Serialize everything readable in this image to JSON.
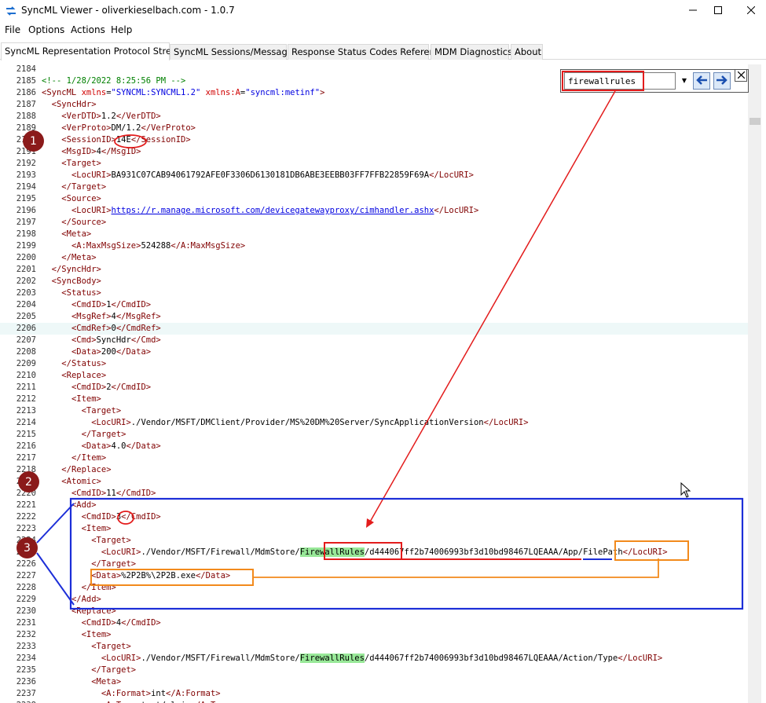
{
  "window": {
    "title": "SyncML Viewer - oliverkieselbach.com - 1.0.7",
    "minimize_icon": "minimize-icon",
    "maximize_icon": "maximize-icon",
    "close_icon": "close-icon"
  },
  "menu": [
    "File",
    "Options",
    "Actions",
    "Help"
  ],
  "tabs": [
    {
      "label": "SyncML Representation Protocol Stream",
      "active": true
    },
    {
      "label": "SyncML Sessions/Messages",
      "active": false
    },
    {
      "label": "Response Status Codes Reference",
      "active": false
    },
    {
      "label": "MDM Diagnostics",
      "active": false
    },
    {
      "label": "About",
      "active": false
    }
  ],
  "find": {
    "value": "firewallrules",
    "prev_icon": "arrow-left-icon",
    "next_icon": "arrow-right-icon",
    "close_icon": "close-icon"
  },
  "markers": [
    "1",
    "2",
    "3"
  ],
  "colors": {
    "tag": "#800000",
    "attribute": "#d00000",
    "string": "#0000e0",
    "comment": "#008000",
    "highlight": "#98e898",
    "annotation_red": "#e31c1c",
    "annotation_orange": "#f28a1c",
    "annotation_blue": "#1c2ed8",
    "marker": "#8b1a1a"
  },
  "editor": {
    "current_line": "2206",
    "lines": [
      {
        "n": "2184",
        "code": ""
      },
      {
        "n": "2185",
        "code": "<!-- 1/28/2022 8:25:56 PM -->"
      },
      {
        "n": "2186",
        "code": "<SyncML xmlns=\"SYNCML:SYNCML1.2\" xmlns:A=\"syncml:metinf\">"
      },
      {
        "n": "2187",
        "code": "  <SyncHdr>"
      },
      {
        "n": "2188",
        "code": "    <VerDTD>1.2</VerDTD>"
      },
      {
        "n": "2189",
        "code": "    <VerProto>DM/1.2</VerProto>"
      },
      {
        "n": "2190",
        "code": "    <SessionID>14E</SessionID>"
      },
      {
        "n": "2191",
        "code": "    <MsgID>4</MsgID>"
      },
      {
        "n": "2192",
        "code": "    <Target>"
      },
      {
        "n": "2193",
        "code": "      <LocURI>BA931C07CAB94061792AFE0F3306D6130181DB6ABE3EEBB03FF7FFB22859F69A</LocURI>"
      },
      {
        "n": "2194",
        "code": "    </Target>"
      },
      {
        "n": "2195",
        "code": "    <Source>"
      },
      {
        "n": "2196",
        "code": "      <LocURI>https://r.manage.microsoft.com/devicegatewayproxy/cimhandler.ashx</LocURI>"
      },
      {
        "n": "2197",
        "code": "    </Source>"
      },
      {
        "n": "2198",
        "code": "    <Meta>"
      },
      {
        "n": "2199",
        "code": "      <A:MaxMsgSize>524288</A:MaxMsgSize>"
      },
      {
        "n": "2200",
        "code": "    </Meta>"
      },
      {
        "n": "2201",
        "code": "  </SyncHdr>"
      },
      {
        "n": "2202",
        "code": "  <SyncBody>"
      },
      {
        "n": "2203",
        "code": "    <Status>"
      },
      {
        "n": "2204",
        "code": "      <CmdID>1</CmdID>"
      },
      {
        "n": "2205",
        "code": "      <MsgRef>4</MsgRef>"
      },
      {
        "n": "2206",
        "code": "      <CmdRef>0</CmdRef>"
      },
      {
        "n": "2207",
        "code": "      <Cmd>SyncHdr</Cmd>"
      },
      {
        "n": "2208",
        "code": "      <Data>200</Data>"
      },
      {
        "n": "2209",
        "code": "    </Status>"
      },
      {
        "n": "2210",
        "code": "    <Replace>"
      },
      {
        "n": "2211",
        "code": "      <CmdID>2</CmdID>"
      },
      {
        "n": "2212",
        "code": "      <Item>"
      },
      {
        "n": "2213",
        "code": "        <Target>"
      },
      {
        "n": "2214",
        "code": "          <LocURI>./Vendor/MSFT/DMClient/Provider/MS%20DM%20Server/SyncApplicationVersion</LocURI>"
      },
      {
        "n": "2215",
        "code": "        </Target>"
      },
      {
        "n": "2216",
        "code": "        <Data>4.0</Data>"
      },
      {
        "n": "2217",
        "code": "      </Item>"
      },
      {
        "n": "2218",
        "code": "    </Replace>"
      },
      {
        "n": "2219",
        "code": "    <Atomic>"
      },
      {
        "n": "2220",
        "code": "      <CmdID>11</CmdID>"
      },
      {
        "n": "2221",
        "code": "      <Add>"
      },
      {
        "n": "2222",
        "code": "        <CmdID>3</CmdID>"
      },
      {
        "n": "2223",
        "code": "        <Item>"
      },
      {
        "n": "2224",
        "code": "          <Target>"
      },
      {
        "n": "2225",
        "code": "            <LocURI>./Vendor/MSFT/Firewall/MdmStore/FirewallRules/d444067ff2b74006993bf3d10bd98467LQEAAA/App/FilePath</LocURI>"
      },
      {
        "n": "2226",
        "code": "          </Target>"
      },
      {
        "n": "2227",
        "code": "          <Data>%2P2B%\\2P2B.exe</Data>"
      },
      {
        "n": "2228",
        "code": "        </Item>"
      },
      {
        "n": "2229",
        "code": "      </Add>"
      },
      {
        "n": "2230",
        "code": "      <Replace>"
      },
      {
        "n": "2231",
        "code": "        <CmdID>4</CmdID>"
      },
      {
        "n": "2232",
        "code": "        <Item>"
      },
      {
        "n": "2233",
        "code": "          <Target>"
      },
      {
        "n": "2234",
        "code": "            <LocURI>./Vendor/MSFT/Firewall/MdmStore/FirewallRules/d444067ff2b74006993bf3d10bd98467LQEAAA/Action/Type</LocURI>"
      },
      {
        "n": "2235",
        "code": "          </Target>"
      },
      {
        "n": "2236",
        "code": "          <Meta>"
      },
      {
        "n": "2237",
        "code": "            <A:Format>int</A:Format>"
      },
      {
        "n": "2238",
        "code": "            <A:Type>text/plain</A:Type>"
      }
    ]
  }
}
